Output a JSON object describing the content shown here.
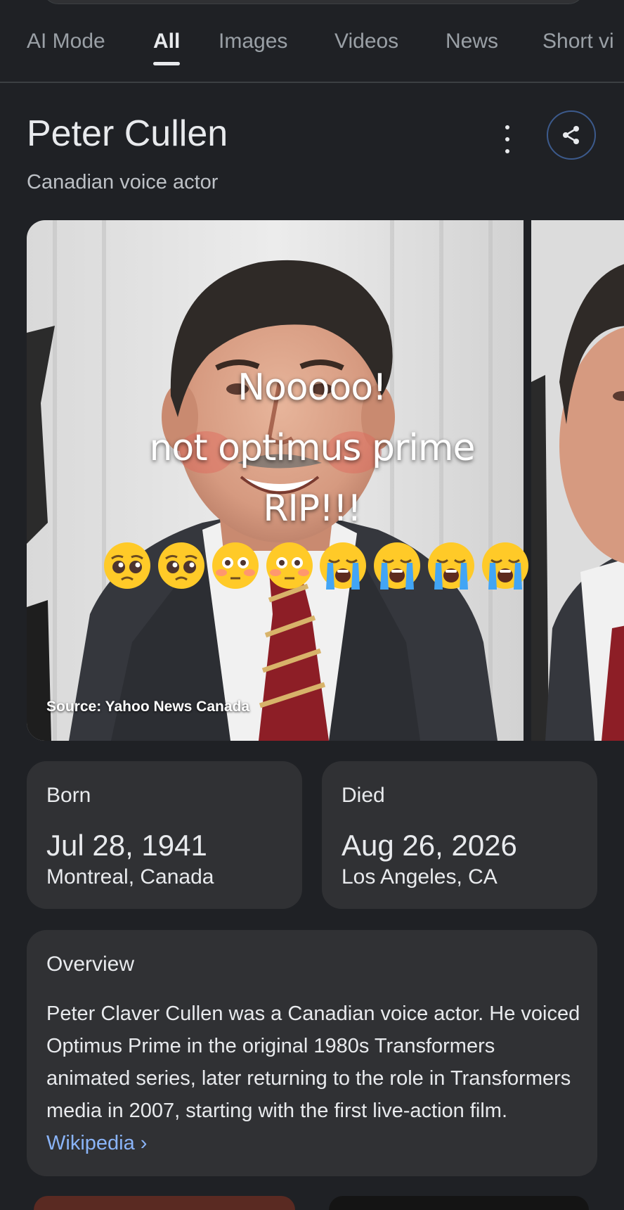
{
  "tabs": [
    {
      "label": "AI Mode"
    },
    {
      "label": "All"
    },
    {
      "label": "Images"
    },
    {
      "label": "Videos"
    },
    {
      "label": "News"
    },
    {
      "label": "Short vi"
    }
  ],
  "header": {
    "title": "Peter Cullen",
    "subtitle": "Canadian voice actor"
  },
  "carousel": {
    "source": "Source: Yahoo News Canada"
  },
  "overlay": {
    "line1": "Nooooo!",
    "line2": "not optimus prime",
    "line3": "RIP!!!",
    "emojis": [
      "pleading-face",
      "pleading-face",
      "flushed-face",
      "flushed-face",
      "loudly-crying-face",
      "loudly-crying-face",
      "loudly-crying-face",
      "loudly-crying-face"
    ]
  },
  "born": {
    "label": "Born",
    "date": "Jul 28, 1941",
    "place": "Montreal, Canada"
  },
  "died": {
    "label": "Died",
    "date": "Aug 26, 2026",
    "place": "Los Angeles, CA"
  },
  "overview": {
    "title": "Overview",
    "text": "Peter Claver Cullen was a Canadian voice actor. He voiced Optimus Prime in the original 1980s Transformers animated series, later returning to the role in Transformers media in 2007, starting with the first live-action film.",
    "link_label": "Wikipedia",
    "link_chevron": "›"
  },
  "colors": {
    "background": "#1f2125",
    "card": "#303134",
    "link": "#8ab4f8",
    "muted_text": "#9aa0a6"
  }
}
